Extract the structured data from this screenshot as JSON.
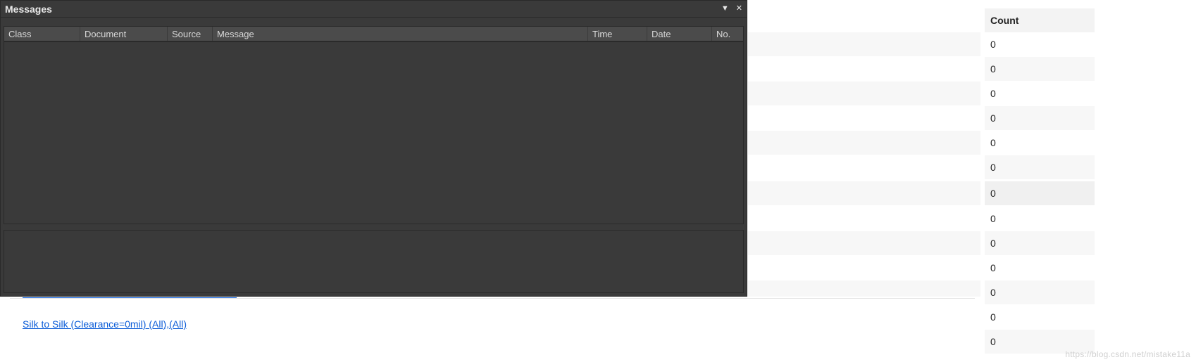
{
  "panel": {
    "title": "Messages",
    "columns": {
      "class": "Class",
      "document": "Document",
      "source": "Source",
      "message": "Message",
      "time": "Time",
      "date": "Date",
      "no": "No."
    }
  },
  "link": {
    "silk_rule": "Silk to Silk (Clearance=0mil) (All),(All)"
  },
  "count_table": {
    "header": "Count",
    "rows": [
      "0",
      "0",
      "0",
      "0",
      "0",
      "0",
      "0",
      "0",
      "0",
      "0",
      "0",
      "0",
      "0"
    ]
  },
  "watermark": "https://blog.csdn.net/mistake11a"
}
